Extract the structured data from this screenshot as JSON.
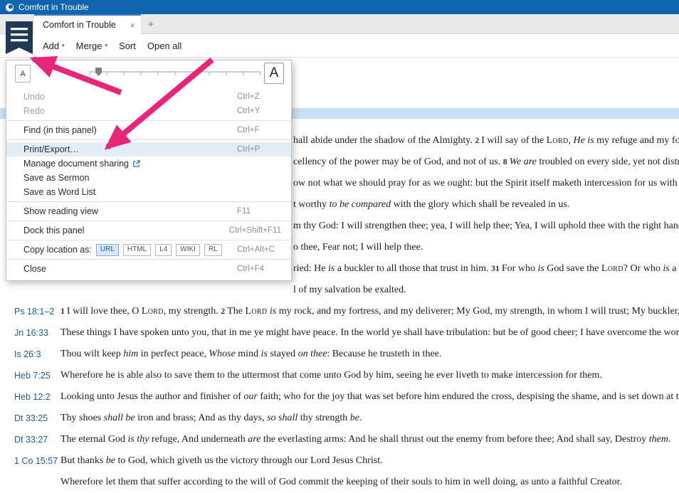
{
  "window": {
    "title": "Comfort in Trouble"
  },
  "tab_bar": {
    "active_tab": "Comfort in Trouble",
    "close_glyph": "×",
    "new_tab_glyph": "+"
  },
  "toolbar": {
    "add": "Add",
    "merge": "Merge",
    "sort": "Sort",
    "open_all": "Open all",
    "caret": "▾"
  },
  "font_size_controls": {
    "decrease": "A",
    "increase": "A"
  },
  "panel_menu": {
    "items": [
      {
        "label": "Undo",
        "shortcut": "Ctrl+Z",
        "disabled": true
      },
      {
        "label": "Redo",
        "shortcut": "Ctrl+Y",
        "disabled": true
      },
      {
        "type": "separator"
      },
      {
        "label": "Find (in this panel)",
        "shortcut": "Ctrl+F"
      },
      {
        "type": "separator"
      },
      {
        "label": "Print/Export…",
        "shortcut": "Ctrl+P",
        "highlighted": true
      },
      {
        "label": "Manage document sharing",
        "external_link_icon": true
      },
      {
        "label": "Save as Sermon"
      },
      {
        "label": "Save as Word List"
      },
      {
        "type": "separator"
      },
      {
        "label": "Show reading view",
        "shortcut": "F11"
      },
      {
        "type": "separator"
      },
      {
        "label": "Dock this panel",
        "shortcut": "Ctrl+Shift+F11"
      },
      {
        "type": "separator"
      },
      {
        "label": "Copy location as:",
        "badges": [
          "URL",
          "HTML",
          "L4",
          "WIKI",
          "RL"
        ],
        "active_badge": "URL",
        "shortcut": "Ctrl+Alt+C"
      },
      {
        "type": "separator"
      },
      {
        "label": "Close",
        "shortcut": "Ctrl+F4"
      }
    ]
  },
  "passages": {
    "rows": [
      {
        "fragment": true,
        "segments": [
          {
            "t": "hall abide under the shadow of the Almighty. "
          },
          {
            "t": "2 ",
            "vn": true
          },
          {
            "t": "I will say of the "
          },
          {
            "t": "Lord",
            "sc": true
          },
          {
            "t": ", "
          },
          {
            "t": "He is",
            "i": true
          },
          {
            "t": " my refuge and my fortress:"
          }
        ]
      },
      {
        "fragment": true,
        "segments": [
          {
            "t": "cellency of the power may be of God, and not of us. "
          },
          {
            "t": "8 ",
            "vn": true
          },
          {
            "t": "We are",
            "i": true
          },
          {
            "t": " troubled on every side, yet not distresse"
          }
        ]
      },
      {
        "fragment": true,
        "segments": [
          {
            "t": "ow not what we should pray for as we ought: but the Spirit itself maketh intercession for us with groa"
          }
        ]
      },
      {
        "fragment": true,
        "segments": [
          {
            "t": "t worthy "
          },
          {
            "t": "to be compared",
            "i": true
          },
          {
            "t": " with the glory which shall be revealed in us."
          }
        ]
      },
      {
        "fragment": true,
        "segments": [
          {
            "t": "m thy God: I will strengthen thee; yea, I will help thee; Yea, I will uphold thee with the right hand of m"
          }
        ]
      },
      {
        "fragment": true,
        "segments": [
          {
            "t": "o thee, Fear not; I will help thee."
          }
        ]
      },
      {
        "fragment": true,
        "segments": [
          {
            "t": "ried: He "
          },
          {
            "t": "is",
            "i": true
          },
          {
            "t": " a buckler to all those that trust in him. "
          },
          {
            "t": "31 ",
            "vn": true
          },
          {
            "t": "For who "
          },
          {
            "t": "is",
            "i": true
          },
          {
            "t": " God save the "
          },
          {
            "t": "Lord",
            "sc": true
          },
          {
            "t": "? Or who "
          },
          {
            "t": "is",
            "i": true
          },
          {
            "t": " a rock s"
          }
        ]
      },
      {
        "fragment": true,
        "segments": [
          {
            "t": "l of my salvation be exalted."
          }
        ]
      },
      {
        "ref": "Ps 18:1–2",
        "segments": [
          {
            "t": "1 ",
            "vn": true
          },
          {
            "t": "I will love thee, O "
          },
          {
            "t": "Lord",
            "sc": true
          },
          {
            "t": ", my strength. "
          },
          {
            "t": "2 ",
            "vn": true
          },
          {
            "t": "The "
          },
          {
            "t": "Lord",
            "sc": true
          },
          {
            "t": " "
          },
          {
            "t": "is",
            "i": true
          },
          {
            "t": " my rock, and my fortress, and my deliverer; My God, my strength, in whom I will trust; My buckler, and the"
          }
        ]
      },
      {
        "ref": "Jn 16:33",
        "segments": [
          {
            "t": "These things I have spoken unto you, that in me ye might have peace. In the world ye shall have tribulation: but be of good cheer; I have overcome the world."
          }
        ]
      },
      {
        "ref": "Is 26:3",
        "segments": [
          {
            "t": "Thou wilt keep "
          },
          {
            "t": "him",
            "i": true
          },
          {
            "t": " in perfect peace, "
          },
          {
            "t": "Whose",
            "i": true
          },
          {
            "t": " mind "
          },
          {
            "t": "is",
            "i": true
          },
          {
            "t": " stayed "
          },
          {
            "t": "on thee",
            "i": true
          },
          {
            "t": ": Because he trusteth in thee."
          }
        ]
      },
      {
        "ref": "Heb 7:25",
        "segments": [
          {
            "t": "Wherefore he is able also to save them to the uttermost that come unto God by him, seeing he ever liveth to make intercession for them."
          }
        ]
      },
      {
        "ref": "Heb 12:2",
        "segments": [
          {
            "t": "Looking unto Jesus the author and finisher of "
          },
          {
            "t": "our",
            "i": true
          },
          {
            "t": " faith; who for the joy that was set before him endured the cross, despising the shame, and is set down at the"
          }
        ]
      },
      {
        "ref": "Dt 33:25",
        "segments": [
          {
            "t": "Thy shoes "
          },
          {
            "t": "shall be",
            "i": true
          },
          {
            "t": " iron and brass; And as thy days, "
          },
          {
            "t": "so shall",
            "i": true
          },
          {
            "t": " thy strength "
          },
          {
            "t": "be",
            "i": true
          },
          {
            "t": "."
          }
        ]
      },
      {
        "ref": "Dt 33:27",
        "segments": [
          {
            "t": "The eternal God "
          },
          {
            "t": "is thy",
            "i": true
          },
          {
            "t": " refuge, And underneath "
          },
          {
            "t": "are",
            "i": true
          },
          {
            "t": " the everlasting arms: And he shall thrust out the enemy from before thee; And shall say, Destroy "
          },
          {
            "t": "them",
            "i": true
          },
          {
            "t": "."
          }
        ]
      },
      {
        "ref": "1 Co 15:57",
        "segments": [
          {
            "t": "But thanks "
          },
          {
            "t": "be",
            "i": true
          },
          {
            "t": " to God, which giveth us the victory through our Lord Jesus Christ."
          }
        ]
      },
      {
        "ref": "",
        "segments": [
          {
            "t": "Wherefore let them that suffer according to the will of God commit the keeping of their souls to him in well doing, as unto a faithful Creator."
          }
        ]
      }
    ]
  }
}
